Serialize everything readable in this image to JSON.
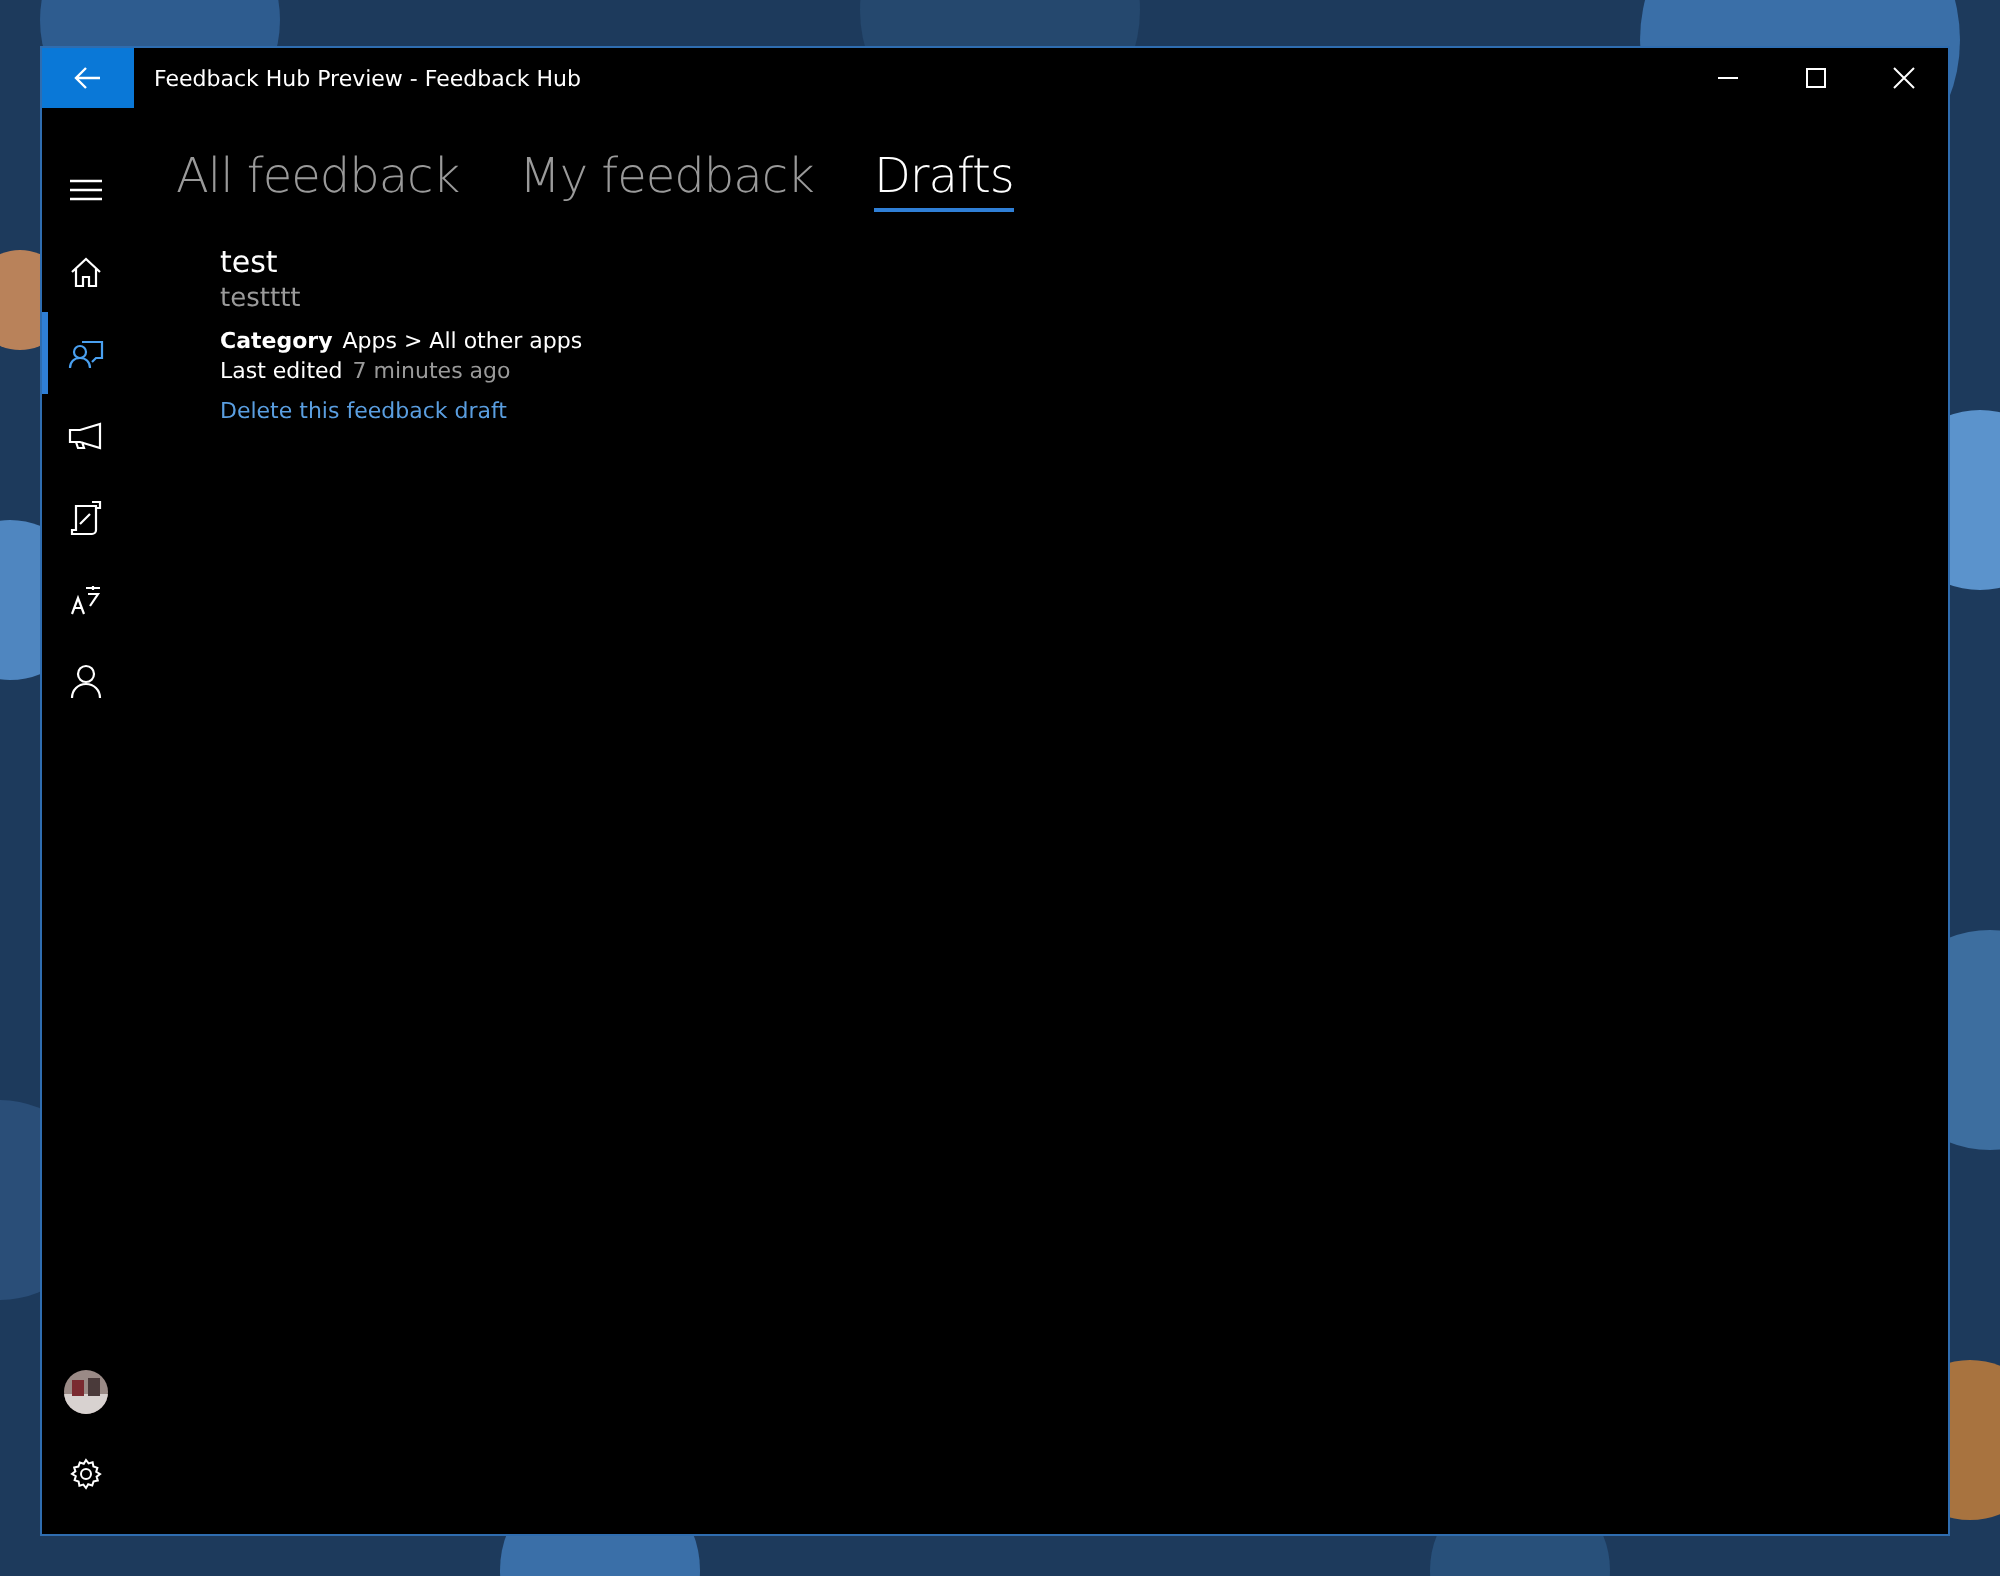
{
  "window": {
    "title": "Feedback Hub Preview - Feedback Hub"
  },
  "nav_items": [
    {
      "kind": "home",
      "selected": false
    },
    {
      "kind": "feedback",
      "selected": true
    },
    {
      "kind": "announcements",
      "selected": false
    },
    {
      "kind": "quests",
      "selected": false
    },
    {
      "kind": "language",
      "selected": false
    },
    {
      "kind": "profile",
      "selected": false
    }
  ],
  "tabs": [
    {
      "label": "All feedback",
      "selected": false
    },
    {
      "label": "My feedback",
      "selected": false
    },
    {
      "label": "Drafts",
      "selected": true
    }
  ],
  "drafts": [
    {
      "title": "test",
      "body": "testttt",
      "category_label": "Category",
      "category": "Apps > All other apps",
      "edited_label": "Last edited",
      "edited": "7 minutes ago",
      "delete_link": "Delete this feedback draft"
    }
  ]
}
